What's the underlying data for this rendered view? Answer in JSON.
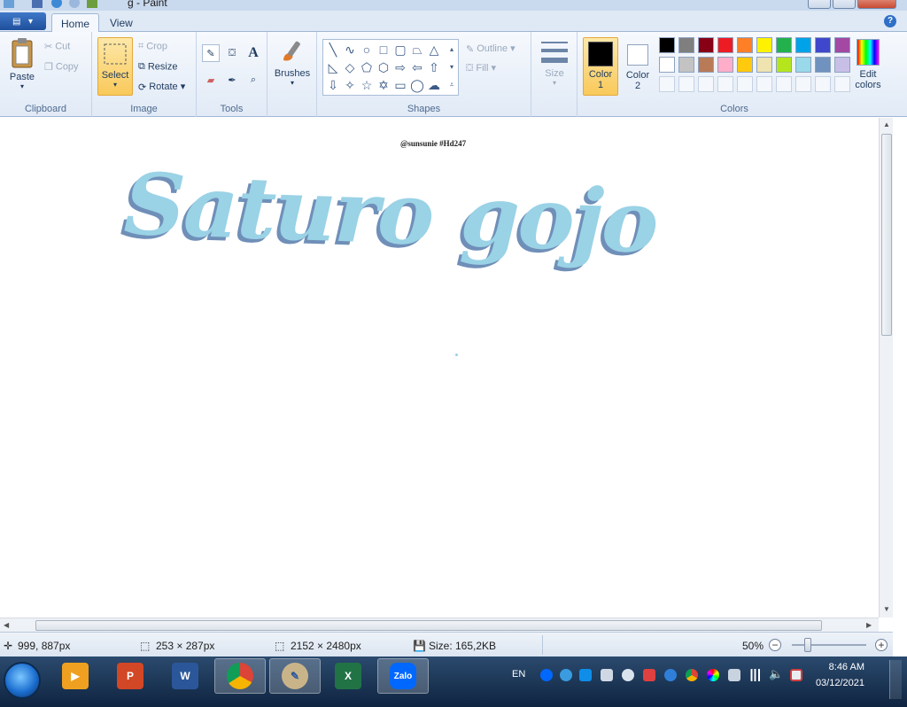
{
  "window": {
    "title": "g - Paint"
  },
  "tabs": [
    {
      "label": "Home",
      "active": true
    },
    {
      "label": "View",
      "active": false
    }
  ],
  "ribbon": {
    "clipboard": {
      "label": "Clipboard",
      "paste": "Paste",
      "cut": "Cut",
      "copy": "Copy"
    },
    "image": {
      "label": "Image",
      "select": "Select",
      "crop": "Crop",
      "resize": "Resize",
      "rotate": "Rotate"
    },
    "tools": {
      "label": "Tools"
    },
    "brushes": {
      "label": "Brushes"
    },
    "shapes": {
      "label": "Shapes",
      "outline": "Outline",
      "fill": "Fill"
    },
    "size": {
      "label": "Size"
    },
    "colors": {
      "label": "Colors",
      "color1_label": "Color\n1",
      "color1_l1": "Color",
      "color1_l2": "1",
      "color2_l1": "Color",
      "color2_l2": "2",
      "edit_l1": "Edit",
      "edit_l2": "colors",
      "color1": "#000000",
      "color2": "#ffffff",
      "palette_row1": [
        "#000000",
        "#7f7f7f",
        "#880015",
        "#ed1c24",
        "#ff7f27",
        "#fff200",
        "#22b14c",
        "#00a2e8",
        "#3f48cc",
        "#a349a4"
      ],
      "palette_row2": [
        "#ffffff",
        "#c3c3c3",
        "#b97a57",
        "#ffaec9",
        "#ffc90e",
        "#efe4b0",
        "#b5e61d",
        "#99d9ea",
        "#7092be",
        "#c8bfe7"
      ]
    }
  },
  "canvas": {
    "caption": "@sunsunie #Hd247",
    "art_text": "Saturo gojo",
    "art_color": "#9ad2e6",
    "shadow_color": "#6f8fb8"
  },
  "status": {
    "cursor": "999, 887px",
    "selection": "253 × 287px",
    "image_size": "2152 × 2480px",
    "file_size": "Size: 165,2KB",
    "zoom": "50%"
  },
  "taskbar": {
    "apps": [
      "Media",
      "PowerPoint",
      "Word",
      "Chrome",
      "Paint",
      "Excel",
      "Zalo"
    ],
    "lang": "EN",
    "zalo_label": "Zalo",
    "time": "8:46 AM",
    "date": "03/12/2021"
  }
}
